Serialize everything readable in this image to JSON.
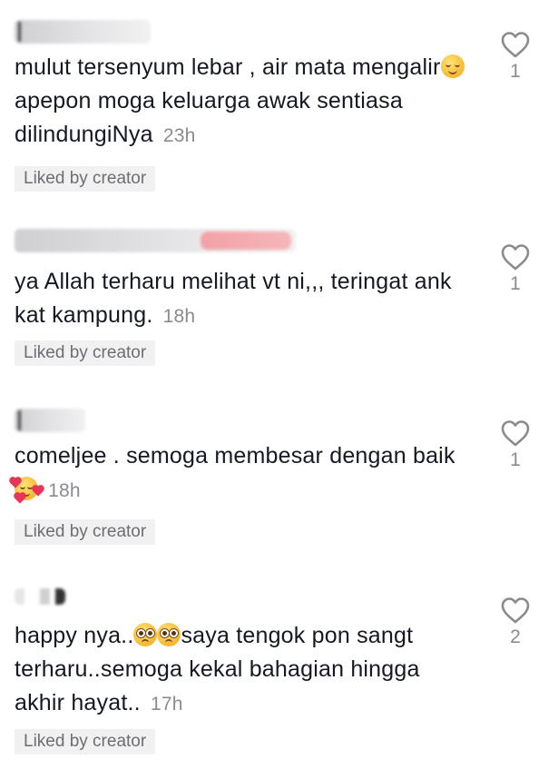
{
  "comments": [
    {
      "text_1": "mulut tersenyum lebar , air mata mengalir",
      "text_2": " apepon moga keluarga awak sentiasa dilindungiNya",
      "time": "23h",
      "liked_label": "Liked by creator",
      "like_count": "1"
    },
    {
      "text_1": "ya Allah terharu melihat vt ni,,, teringat ank kat kampung.",
      "time": "18h",
      "liked_label": "Liked by creator",
      "like_count": "1"
    },
    {
      "text_1": "comeljee . semoga membesar dengan baik ",
      "time": "18h",
      "liked_label": "Liked by creator",
      "like_count": "1"
    },
    {
      "text_1": "happy nya..",
      "text_2": "saya tengok pon sangt terharu..semoga kekal bahagian hingga akhir hayat..",
      "time": "17h",
      "liked_label": "Liked by creator",
      "like_count": "2"
    }
  ],
  "icons": {
    "like": "heart-outline-icon",
    "emoji_1": "relieved-face-emoji",
    "emoji_3": "smiling-face-with-hearts-emoji",
    "emoji_4": "pleading-face-emoji"
  },
  "colors": {
    "text": "#161823",
    "muted": "#8a8b91",
    "badge_bg": "#f1f1f2"
  }
}
